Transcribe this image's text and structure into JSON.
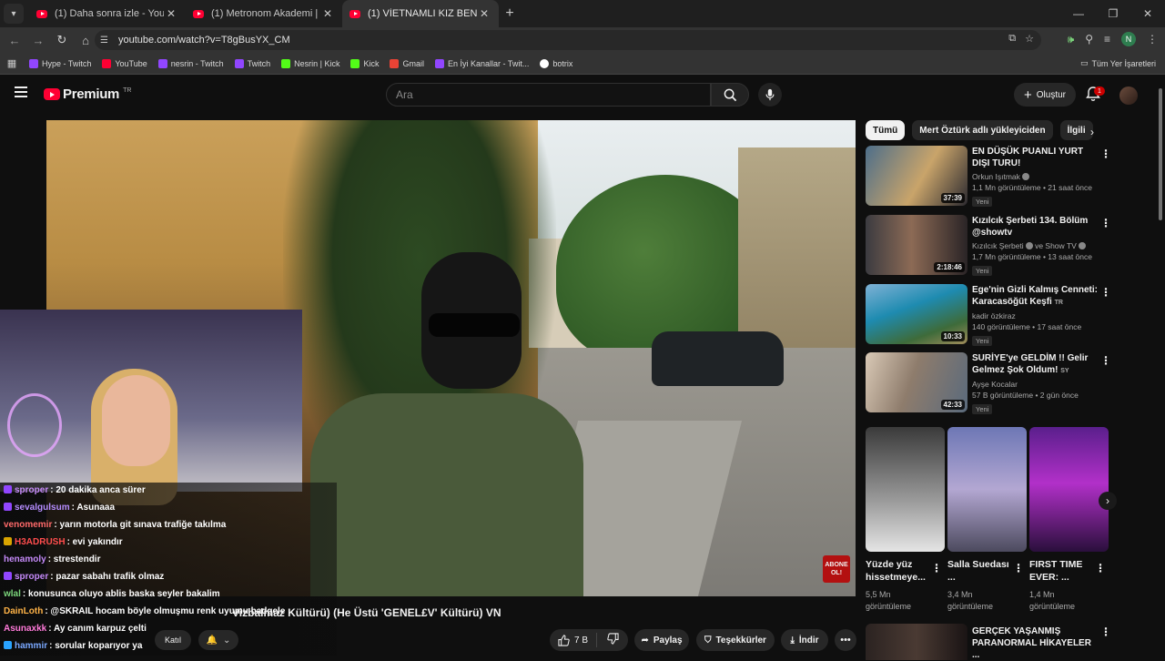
{
  "browser": {
    "tabs": [
      {
        "label": "(1) Daha sonra izle - YouTube",
        "active": false
      },
      {
        "label": "(1) Metronom Akademi | 19. Bö",
        "active": false
      },
      {
        "label": "(1) VİETNAMLI KIZ BENİ TEZGA",
        "active": true
      }
    ],
    "url": "youtube.com/watch?v=T8gBusYX_CM",
    "bookmarks": [
      {
        "label": "Hype - Twitch",
        "color": "#9146ff"
      },
      {
        "label": "YouTube",
        "color": "#ff0033"
      },
      {
        "label": "nesrin - Twitch",
        "color": "#9146ff"
      },
      {
        "label": "Twitch",
        "color": "#9146ff"
      },
      {
        "label": "Nesrin | Kick",
        "color": "#53fc18"
      },
      {
        "label": "Kick",
        "color": "#53fc18"
      },
      {
        "label": "Gmail",
        "color": "#ea4335"
      },
      {
        "label": "En İyi Kanallar - Twit...",
        "color": "#9146ff"
      },
      {
        "label": "botrix",
        "color": "#ffffff"
      }
    ],
    "bookmarks_folder": "Tüm Yer İşaretleri",
    "profile_initial": "N"
  },
  "youtube": {
    "logo_text": "Premium",
    "logo_region": "TR",
    "search_placeholder": "Ara",
    "create_label": "Oluştur",
    "notification_count": "1"
  },
  "video": {
    "subscribe_overlay": "ABONE OL!",
    "title": "Vizbalmaz Kültürü) (He Üstü 'GENEL£V' Kültürü) VN",
    "join_label": "Katıl",
    "likes": "7 B",
    "share_label": "Paylaş",
    "thanks_label": "Teşekkürler",
    "download_label": "İndir"
  },
  "chat": [
    {
      "user": "sproper",
      "text": ": 20 dakika anca sürer",
      "color": "#c58af9",
      "badge": "#9146ff"
    },
    {
      "user": "sevalgulsum",
      "text": ": Asunaaa",
      "color": "#b58cff",
      "badge": "#9146ff"
    },
    {
      "user": "venomemir",
      "text": ": yarın motorla git sınava trafiğe takılma",
      "color": "#ff6a6a",
      "badge": ""
    },
    {
      "user": "H3ADRUSH",
      "text": ": evi yakındır",
      "color": "#ff4d4d",
      "badge": "#d9a400"
    },
    {
      "user": "henamoly",
      "text": ": strestendir",
      "color": "#c58af9",
      "badge": ""
    },
    {
      "user": "sproper",
      "text": ": pazar sabahı trafik olmaz",
      "color": "#c58af9",
      "badge": "#9146ff"
    },
    {
      "user": "wlal",
      "text": ": konusunca oluyo ablis baska seyler bakalim",
      "color": "#7cd67c",
      "badge": ""
    },
    {
      "user": "DainLoth",
      "text": ": @SKRAIL hocam böyle olmuşmu renk uyumu badgele",
      "color": "#ffb347",
      "badge": ""
    },
    {
      "user": "Asunaxkk",
      "text": ": Ay canım karpuz çelti",
      "color": "#ff7ad9",
      "badge": ""
    },
    {
      "user": "hammir",
      "text": ": sorular koparıyor ya",
      "color": "#7aa8ff",
      "badge": "#29a3ff"
    }
  ],
  "sidebar": {
    "chips": [
      "Tümü",
      "Mert Öztürk adlı yükleyiciden",
      "İlgili"
    ],
    "recommendations": [
      {
        "title": "EN DÜŞÜK PUANLI YURT DIŞI TURU!",
        "channel": "Orkun Işıtmak",
        "verified": true,
        "meta": "1,1 Mn görüntüleme • 21 saat önce",
        "badge": "Yeni",
        "duration": "37:39"
      },
      {
        "title": "Kızılcık Şerbeti 134. Bölüm @showtv",
        "channel": "Kızılcık Şerbeti",
        "channel2": "ve Show TV",
        "verified": true,
        "meta": "1,7 Mn görüntüleme • 13 saat önce",
        "badge": "Yeni",
        "duration": "2:18:46"
      },
      {
        "title": "Ege'nin Gizli Kalmış Cenneti: Karacasöğüt Keşfi",
        "title_tag": "TR",
        "channel": "kadir özkiraz",
        "verified": false,
        "meta": "140 görüntüleme • 17 saat önce",
        "badge": "Yeni",
        "duration": "10:33"
      },
      {
        "title": "SURİYE'ye GELDİM !! Gelir Gelmez Şok Oldum!",
        "title_tag": "SY",
        "channel": "Ayşe Kocalar",
        "verified": false,
        "meta": "57 B görüntüleme • 2 gün önce",
        "badge": "Yeni",
        "duration": "42:33"
      }
    ],
    "shorts": [
      {
        "title": "Yüzde yüz hissetmeye...",
        "views_line1": "5,5 Mn",
        "views_line2": "görüntüleme"
      },
      {
        "title": "Salla Suedası ...",
        "views_line1": "3,4 Mn",
        "views_line2": "görüntüleme"
      },
      {
        "title": "FIRST TIME EVER: ...",
        "views_line1": "1,4 Mn",
        "views_line2": "görüntüleme"
      }
    ],
    "bottom_rec_title": "GERÇEK YAŞANMIŞ PARANORMAL HİKAYELER ..."
  }
}
